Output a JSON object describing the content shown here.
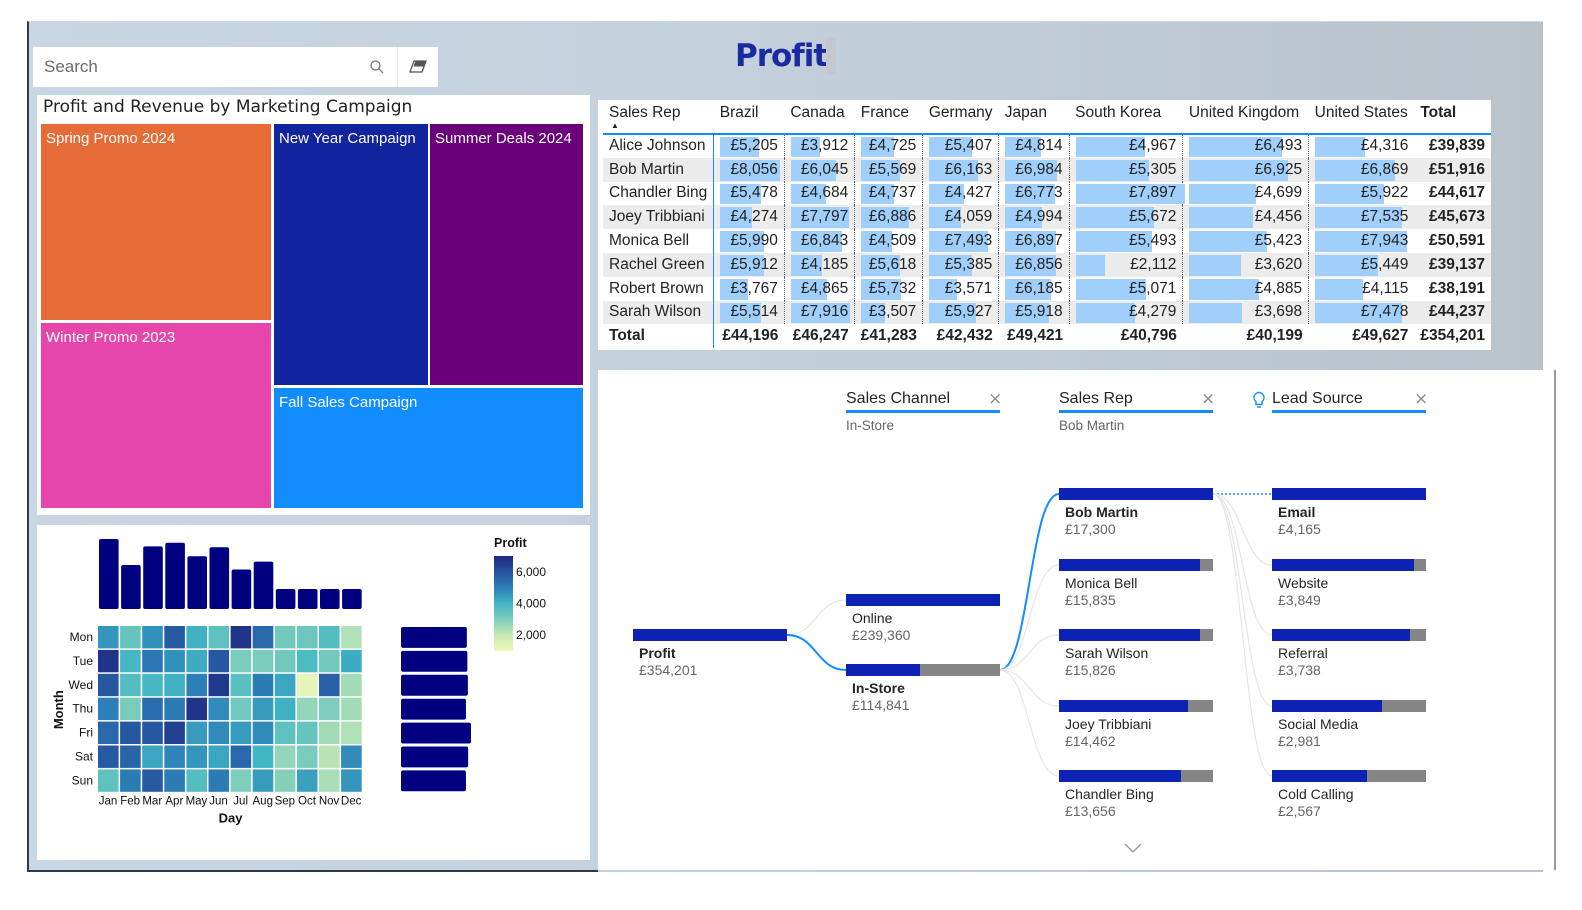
{
  "page_title": "Profit",
  "search": {
    "placeholder": "Search"
  },
  "treemap": {
    "title": "Profit and Revenue by Marketing Campaign",
    "tiles": [
      {
        "label": "Spring Promo 2024",
        "color": "#e66c37"
      },
      {
        "label": "New Year Campaign",
        "color": "#12239e"
      },
      {
        "label": "Summer Deals 2024",
        "color": "#6b007b"
      },
      {
        "label": "Winter Promo 2023",
        "color": "#e645ab"
      },
      {
        "label": "Fall Sales Campaign",
        "color": "#118dff"
      }
    ]
  },
  "matrix": {
    "corner_header": "Sales Rep",
    "columns": [
      "Brazil",
      "Canada",
      "France",
      "Germany",
      "Japan",
      "South Korea",
      "United Kingdom",
      "United States"
    ],
    "total_header": "Total",
    "rows": [
      {
        "name": "Alice Johnson",
        "values": [
          "£5,205",
          "£3,912",
          "£4,725",
          "£5,407",
          "£4,814",
          "£4,967",
          "£6,493",
          "£4,316"
        ],
        "raw": [
          5205,
          3912,
          4725,
          5407,
          4814,
          4967,
          6493,
          4316
        ],
        "total": "£39,839"
      },
      {
        "name": "Bob Martin",
        "values": [
          "£8,056",
          "£6,045",
          "£5,569",
          "£6,163",
          "£6,984",
          "£5,305",
          "£6,925",
          "£6,869"
        ],
        "raw": [
          8056,
          6045,
          5569,
          6163,
          6984,
          5305,
          6925,
          6869
        ],
        "total": "£51,916"
      },
      {
        "name": "Chandler Bing",
        "values": [
          "£5,478",
          "£4,684",
          "£4,737",
          "£4,427",
          "£6,773",
          "£7,897",
          "£4,699",
          "£5,922"
        ],
        "raw": [
          5478,
          4684,
          4737,
          4427,
          6773,
          7897,
          4699,
          5922
        ],
        "total": "£44,617"
      },
      {
        "name": "Joey Tribbiani",
        "values": [
          "£4,274",
          "£7,797",
          "£6,886",
          "£4,059",
          "£4,994",
          "£5,672",
          "£4,456",
          "£7,535"
        ],
        "raw": [
          4274,
          7797,
          6886,
          4059,
          4994,
          5672,
          4456,
          7535
        ],
        "total": "£45,673"
      },
      {
        "name": "Monica Bell",
        "values": [
          "£5,990",
          "£6,843",
          "£4,509",
          "£7,493",
          "£6,897",
          "£5,493",
          "£5,423",
          "£7,943"
        ],
        "raw": [
          5990,
          6843,
          4509,
          7493,
          6897,
          5493,
          5423,
          7943
        ],
        "total": "£50,591"
      },
      {
        "name": "Rachel Green",
        "values": [
          "£5,912",
          "£4,185",
          "£5,618",
          "£5,385",
          "£6,856",
          "£2,112",
          "£3,620",
          "£5,449"
        ],
        "raw": [
          5912,
          4185,
          5618,
          5385,
          6856,
          2112,
          3620,
          5449
        ],
        "total": "£39,137"
      },
      {
        "name": "Robert Brown",
        "values": [
          "£3,767",
          "£4,865",
          "£5,732",
          "£3,571",
          "£6,185",
          "£5,071",
          "£4,885",
          "£4,115"
        ],
        "raw": [
          3767,
          4865,
          5732,
          3571,
          6185,
          5071,
          4885,
          4115
        ],
        "total": "£38,191"
      },
      {
        "name": "Sarah Wilson",
        "values": [
          "£5,514",
          "£7,916",
          "£3,507",
          "£5,927",
          "£5,918",
          "£4,279",
          "£3,698",
          "£7,478"
        ],
        "raw": [
          5514,
          7916,
          3507,
          5927,
          5918,
          4279,
          3698,
          7478
        ],
        "total": "£44,237"
      }
    ],
    "total_row": {
      "label": "Total",
      "values": [
        "£44,196",
        "£46,247",
        "£41,283",
        "£42,432",
        "£49,421",
        "£40,796",
        "£40,199",
        "£49,627"
      ],
      "total": "£354,201"
    },
    "bar_color": "#9fcffa"
  },
  "decomposition": {
    "levels": [
      {
        "header": "Sales Channel",
        "selected": "In-Store",
        "close": "×"
      },
      {
        "header": "Sales Rep",
        "selected": "Bob Martin",
        "close": "×"
      },
      {
        "header": "Lead Source",
        "selected": "",
        "close": "×",
        "ai_icon": "lightbulb-icon"
      }
    ],
    "root": {
      "name": "Profit",
      "value": "£354,201",
      "share": 1.0
    },
    "channel_nodes": [
      {
        "name": "Online",
        "value": "£239,360",
        "share": 1.0,
        "selected": false
      },
      {
        "name": "In-Store",
        "value": "£114,841",
        "share": 0.48,
        "selected": true
      }
    ],
    "rep_nodes": [
      {
        "name": "Bob Martin",
        "value": "£17,300",
        "share": 1.0,
        "selected": true
      },
      {
        "name": "Monica Bell",
        "value": "£15,835",
        "share": 0.915,
        "selected": false
      },
      {
        "name": "Sarah Wilson",
        "value": "£15,826",
        "share": 0.915,
        "selected": false
      },
      {
        "name": "Joey Tribbiani",
        "value": "£14,462",
        "share": 0.836,
        "selected": false
      },
      {
        "name": "Chandler Bing",
        "value": "£13,656",
        "share": 0.789,
        "selected": false
      }
    ],
    "lead_nodes": [
      {
        "name": "Email",
        "value": "£4,165",
        "share": 1.0,
        "selected": true
      },
      {
        "name": "Website",
        "value": "£3,849",
        "share": 0.924,
        "selected": false
      },
      {
        "name": "Referral",
        "value": "£3,738",
        "share": 0.897,
        "selected": false
      },
      {
        "name": "Social Media",
        "value": "£2,981",
        "share": 0.716,
        "selected": false
      },
      {
        "name": "Cold Calling",
        "value": "£2,567",
        "share": 0.616,
        "selected": false
      }
    ],
    "more_icon": "chevron-down-icon",
    "colors": {
      "bar": "#0c22b4",
      "remainder": "#858585",
      "active_link": "#118dff"
    }
  },
  "chart_data": {
    "type": "heatmap",
    "title": "",
    "xlabel": "Day",
    "ylabel": "Month",
    "x": [
      "Jan",
      "Feb",
      "Mar",
      "Apr",
      "May",
      "Jun",
      "Jul",
      "Aug",
      "Sep",
      "Oct",
      "Nov",
      "Dec"
    ],
    "y": [
      "Mon",
      "Tue",
      "Wed",
      "Thu",
      "Fri",
      "Sat",
      "Sun"
    ],
    "values": [
      [
        4600,
        3400,
        4700,
        5800,
        4100,
        3500,
        6700,
        5500,
        3200,
        3300,
        3700,
        2300
      ],
      [
        6700,
        3900,
        5200,
        4700,
        4200,
        5900,
        3100,
        3100,
        3200,
        3800,
        3200,
        4200
      ],
      [
        5900,
        3700,
        3900,
        4100,
        5000,
        6600,
        3600,
        5100,
        4300,
        1200,
        5700,
        2500
      ],
      [
        5000,
        3100,
        5400,
        5100,
        6700,
        4800,
        3200,
        4500,
        4100,
        2700,
        3000,
        2500
      ],
      [
        5500,
        5900,
        5900,
        6400,
        4500,
        4800,
        4500,
        4800,
        3500,
        3400,
        2500,
        2300
      ],
      [
        5800,
        5600,
        4300,
        4900,
        4600,
        4300,
        5500,
        4000,
        2700,
        3100,
        2200,
        4800
      ],
      [
        3500,
        5100,
        5800,
        5100,
        3700,
        5100,
        3000,
        4500,
        2900,
        4400,
        2400,
        4600
      ]
    ],
    "legend": {
      "title": "Profit",
      "ticks": [
        2000,
        4000,
        6000
      ],
      "range": [
        1000,
        7000
      ],
      "position": "top-right"
    },
    "marginal_bars": {
      "top": "column sums",
      "right": "row sums",
      "color": "#000080"
    }
  }
}
